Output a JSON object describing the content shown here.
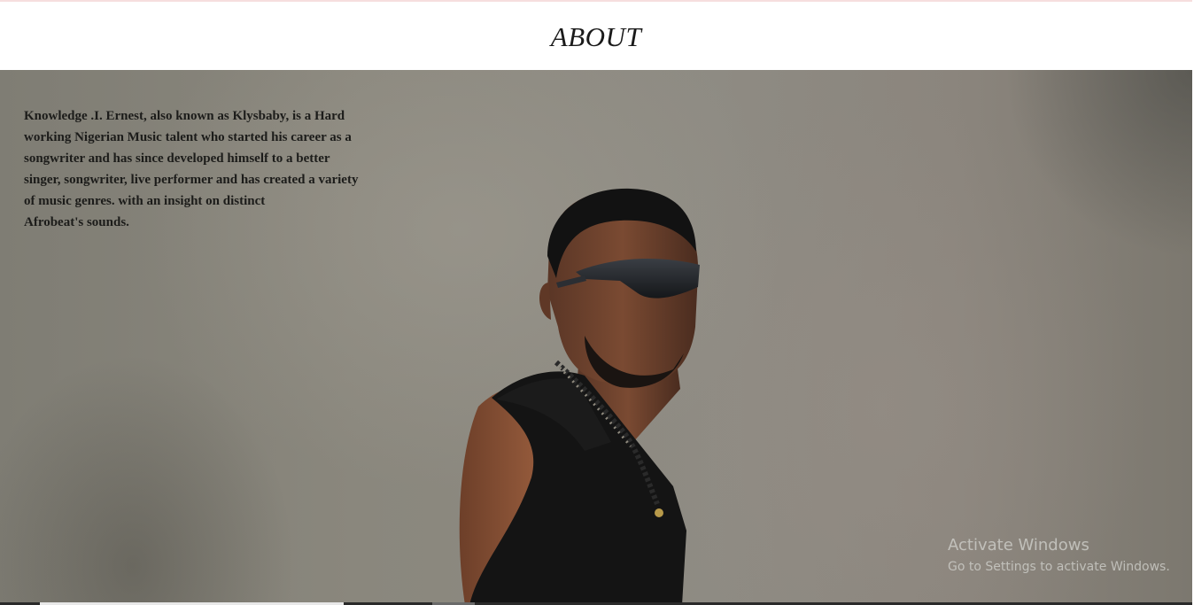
{
  "header": {
    "title": "ABOUT"
  },
  "about": {
    "bio_lines": [
      "Knowledge .I. Ernest, also known as Klysbaby, is a Hard",
      "working Nigerian Music talent who started his career as a",
      "songwriter and has since developed himself to a better",
      "singer, songwriter, live performer and has created a variety",
      "of music genres. with an insight on distinct",
      "Afrobeat's sounds."
    ]
  },
  "watermark": {
    "title": "Activate Windows",
    "subtitle": "Go to Settings to activate Windows."
  },
  "colors": {
    "header_background": "#ffffff",
    "title_text": "#1a1a1a",
    "hero_background": "#8a877d",
    "bio_text": "#1c1c1a"
  }
}
